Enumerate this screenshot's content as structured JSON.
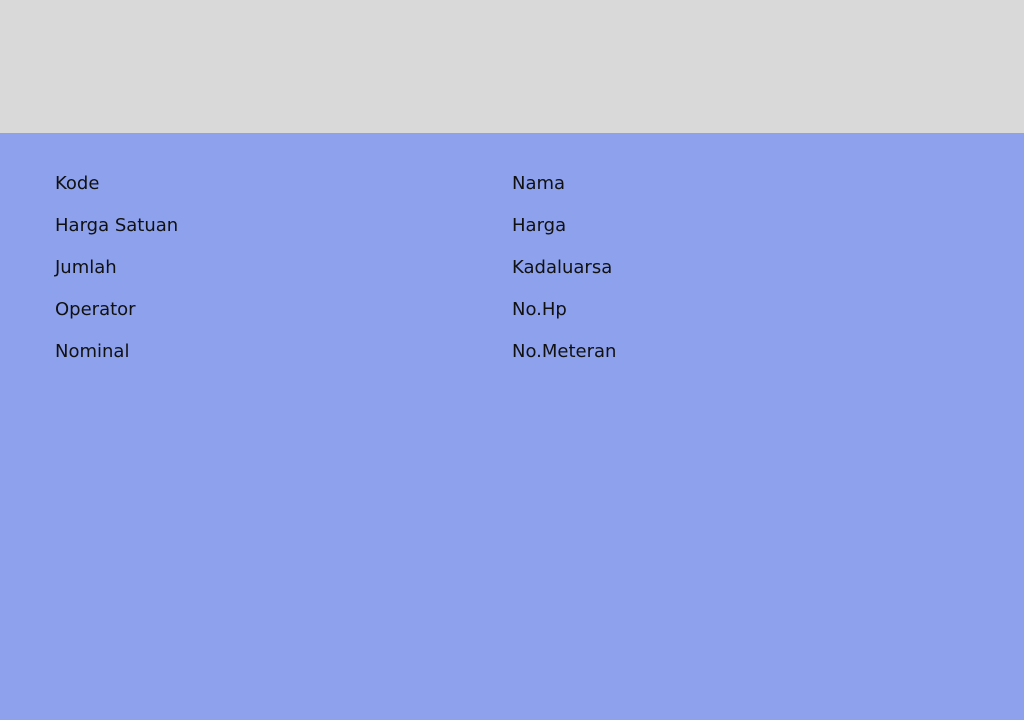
{
  "colors": {
    "header_background": "#d9d9d9",
    "form_background": "#8da1ec",
    "label_text": "#111111"
  },
  "form": {
    "left_labels": [
      "Kode",
      "Harga Satuan",
      "Jumlah",
      "Operator",
      "Nominal"
    ],
    "right_labels": [
      "Nama",
      "Harga",
      "Kadaluarsa",
      "No.Hp",
      "No.Meteran"
    ]
  }
}
